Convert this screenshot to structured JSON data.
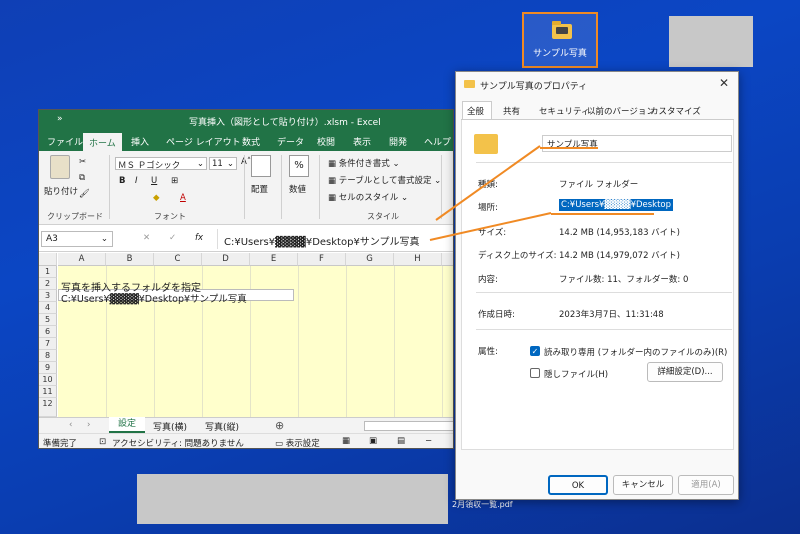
{
  "desktop": {
    "folder_label": "サンプル写真",
    "pdf_label": "2月領収一覧.pdf",
    "colors": {
      "background": "#0b46c4",
      "highlight": "#f08a24"
    }
  },
  "excel": {
    "title": "写真挿入（図形として貼り付け）.xlsm  -  Excel",
    "qat": "»",
    "tabs": [
      "ファイル",
      "ホーム",
      "挿入",
      "ページ レイアウト",
      "数式",
      "データ",
      "校閲",
      "表示",
      "開発",
      "ヘルプ"
    ],
    "active_tab": "ホーム",
    "ribbon": {
      "paste": "貼り付け",
      "clipboard_group": "クリップボード",
      "font_name": "ＭＳ Ｐゴシック",
      "font_size": "11",
      "bold": "B",
      "italic": "I",
      "underline": "U",
      "font_group": "フォント",
      "align": "配置",
      "number": "数値",
      "percent": "%",
      "conditional": "条件付き書式",
      "table_format": "テーブルとして書式設定",
      "cell_style": "セルのスタイル",
      "style_group": "スタイル"
    },
    "name_box": "A3",
    "formula_value": "C:¥Users¥▓▓▓▓¥Desktop¥サンプル写真",
    "columns": [
      "A",
      "B",
      "C",
      "D",
      "E",
      "F",
      "G",
      "H"
    ],
    "rows": [
      "1",
      "2",
      "3",
      "4",
      "5",
      "6",
      "7",
      "8",
      "9",
      "10",
      "11",
      "12"
    ],
    "cells": {
      "A2": "写真を挿入するフォルダを指定",
      "A3": "C:¥Users¥▓▓▓▓¥Desktop¥サンプル写真"
    },
    "sheets": [
      "設定",
      "写真(横)",
      "写真(縦)"
    ],
    "active_sheet": "設定",
    "status": {
      "ready": "準備完了",
      "accessibility": "アクセシビリティ: 問題ありません",
      "display": "表示設定"
    },
    "colors": {
      "brand": "#217346",
      "cell_fill": "#ffffcc"
    }
  },
  "dialog": {
    "title": "サンプル写真のプロパティ",
    "tabs": [
      "全般",
      "共有",
      "セキュリティ",
      "以前のバージョン",
      "カスタマイズ"
    ],
    "name_value": "サンプル写真",
    "fields": [
      {
        "label": "種類:",
        "value": "ファイル フォルダー"
      },
      {
        "label": "場所:",
        "value": "C:¥Users¥▓▓▓▓¥Desktop"
      },
      {
        "label": "サイズ:",
        "value": "14.2 MB (14,953,183 バイト)"
      },
      {
        "label": "ディスク上のサイズ:",
        "value": "14.2 MB (14,979,072 バイト)"
      },
      {
        "label": "内容:",
        "value": "ファイル数: 11、フォルダー数: 0"
      },
      {
        "label": "作成日時:",
        "value": "2023年3月7日、11:31:48"
      },
      {
        "label": "属性:",
        "value": ""
      }
    ],
    "readonly_label": "読み取り専用 (フォルダー内のファイルのみ)(R)",
    "readonly_checked": true,
    "hidden_label": "隠しファイル(H)",
    "hidden_checked": false,
    "advanced_button": "詳細設定(D)...",
    "ok": "OK",
    "cancel": "キャンセル",
    "apply": "適用(A)",
    "close": "✕"
  }
}
